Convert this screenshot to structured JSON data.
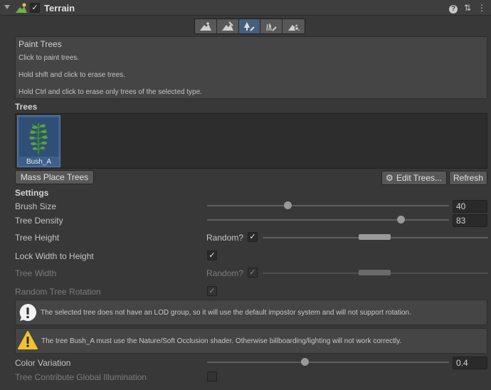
{
  "header": {
    "title": "Terrain",
    "enabled_mark": "✓",
    "help_icon": "?",
    "settings_icon": "⇅",
    "menu_icon": "⋮"
  },
  "toolbar": {
    "tools": [
      "raise-lower-icon",
      "paint-texture-icon",
      "paint-trees-icon",
      "paint-details-icon",
      "terrain-settings-icon"
    ],
    "active_tool": "paint-trees"
  },
  "help": {
    "title": "Paint Trees",
    "lines": [
      "Click to paint trees.",
      "Hold shift and click to erase trees.",
      "Hold Ctrl and click to erase only trees of the selected type."
    ]
  },
  "trees": {
    "label": "Trees",
    "items": [
      {
        "name": "Bush_A",
        "selected": true
      }
    ]
  },
  "buttons": {
    "mass_place": "Mass Place Trees",
    "edit_trees": "Edit Trees...",
    "refresh": "Refresh"
  },
  "settings": {
    "label": "Settings",
    "brush_size": {
      "label": "Brush Size",
      "value": "40",
      "fraction": 0.33
    },
    "tree_density": {
      "label": "Tree Density",
      "value": "83",
      "fraction": 0.83
    },
    "tree_height": {
      "label": "Tree Height",
      "random_label": "Random?",
      "random": true,
      "range_min": 0.5,
      "range_max": 0.6
    },
    "lock_width": {
      "label": "Lock Width to Height",
      "checked": true
    },
    "tree_width": {
      "label": "Tree Width",
      "random_label": "Random?",
      "random": true,
      "range_min": 0.5,
      "range_max": 0.6
    },
    "random_rotation": {
      "label": "Random Tree Rotation",
      "checked": true
    },
    "color_variation": {
      "label": "Color Variation",
      "value": "0.4",
      "fraction": 0.4
    },
    "contribute_gi": {
      "label": "Tree Contribute Global Illumination",
      "checked": false
    }
  },
  "messages": {
    "info": "The selected tree does not have an LOD group, so it will use the default impostor system and will not support rotation.",
    "warning": "The tree Bush_A must use the Nature/Soft Occlusion shader. Otherwise billboarding/lighting will not work correctly."
  },
  "colors": {
    "active_tool": "#46607c",
    "selected_tree": "#3d5f8a",
    "warning": "#f2c230"
  }
}
